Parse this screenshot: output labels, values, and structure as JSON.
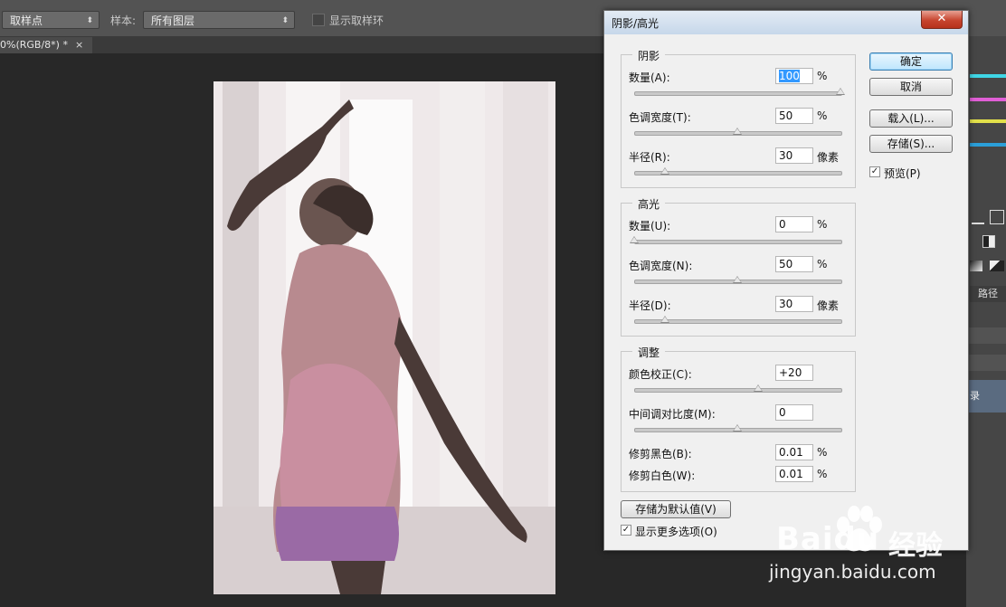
{
  "options_bar": {
    "tool_select": "取样点",
    "sample_label": "样本:",
    "sample_select": "所有图层",
    "show_ring_label": "显示取样环"
  },
  "document_tab": {
    "title": "0%(RGB/8*) *",
    "close": "×"
  },
  "right_panel": {
    "tab_label": "路径",
    "row_label": "录"
  },
  "dialog": {
    "title": "阴影/高光",
    "close_glyph": "✕",
    "shadows": {
      "title": "阴影",
      "amount_label": "数量(A):",
      "amount_value": "100",
      "amount_unit": "%",
      "amount_level": 1.0,
      "tonal_label": "色调宽度(T):",
      "tonal_value": "50",
      "tonal_unit": "%",
      "tonal_level": 0.5,
      "radius_label": "半径(R):",
      "radius_value": "30",
      "radius_unit": "像素",
      "radius_level": 0.15
    },
    "highlights": {
      "title": "高光",
      "amount_label": "数量(U):",
      "amount_value": "0",
      "amount_unit": "%",
      "amount_level": 0.0,
      "tonal_label": "色调宽度(N):",
      "tonal_value": "50",
      "tonal_unit": "%",
      "tonal_level": 0.5,
      "radius_label": "半径(D):",
      "radius_value": "30",
      "radius_unit": "像素",
      "radius_level": 0.15
    },
    "adjustments": {
      "title": "调整",
      "color_label": "颜色校正(C):",
      "color_value": "+20",
      "color_level": 0.6,
      "midtone_label": "中间调对比度(M):",
      "midtone_value": "0",
      "midtone_level": 0.5,
      "black_label": "修剪黑色(B):",
      "black_value": "0.01",
      "black_unit": "%",
      "white_label": "修剪白色(W):",
      "white_value": "0.01",
      "white_unit": "%"
    },
    "save_default_label": "存储为默认值(V)",
    "more_options_label": "显示更多选项(O)",
    "more_options_checked": true,
    "ok_label": "确定",
    "cancel_label": "取消",
    "load_label": "载入(L)...",
    "save_label": "存储(S)...",
    "preview_label": "预览(P)",
    "preview_checked": true
  },
  "watermark": {
    "brand": "Baidu",
    "brand_cn": "经验",
    "url": "jingyan.baidu.com"
  },
  "colors": {
    "app_bg": "#282828",
    "options_bg": "#535353",
    "dialog_bg": "#f0f0f0",
    "accent": "#3399ff"
  }
}
